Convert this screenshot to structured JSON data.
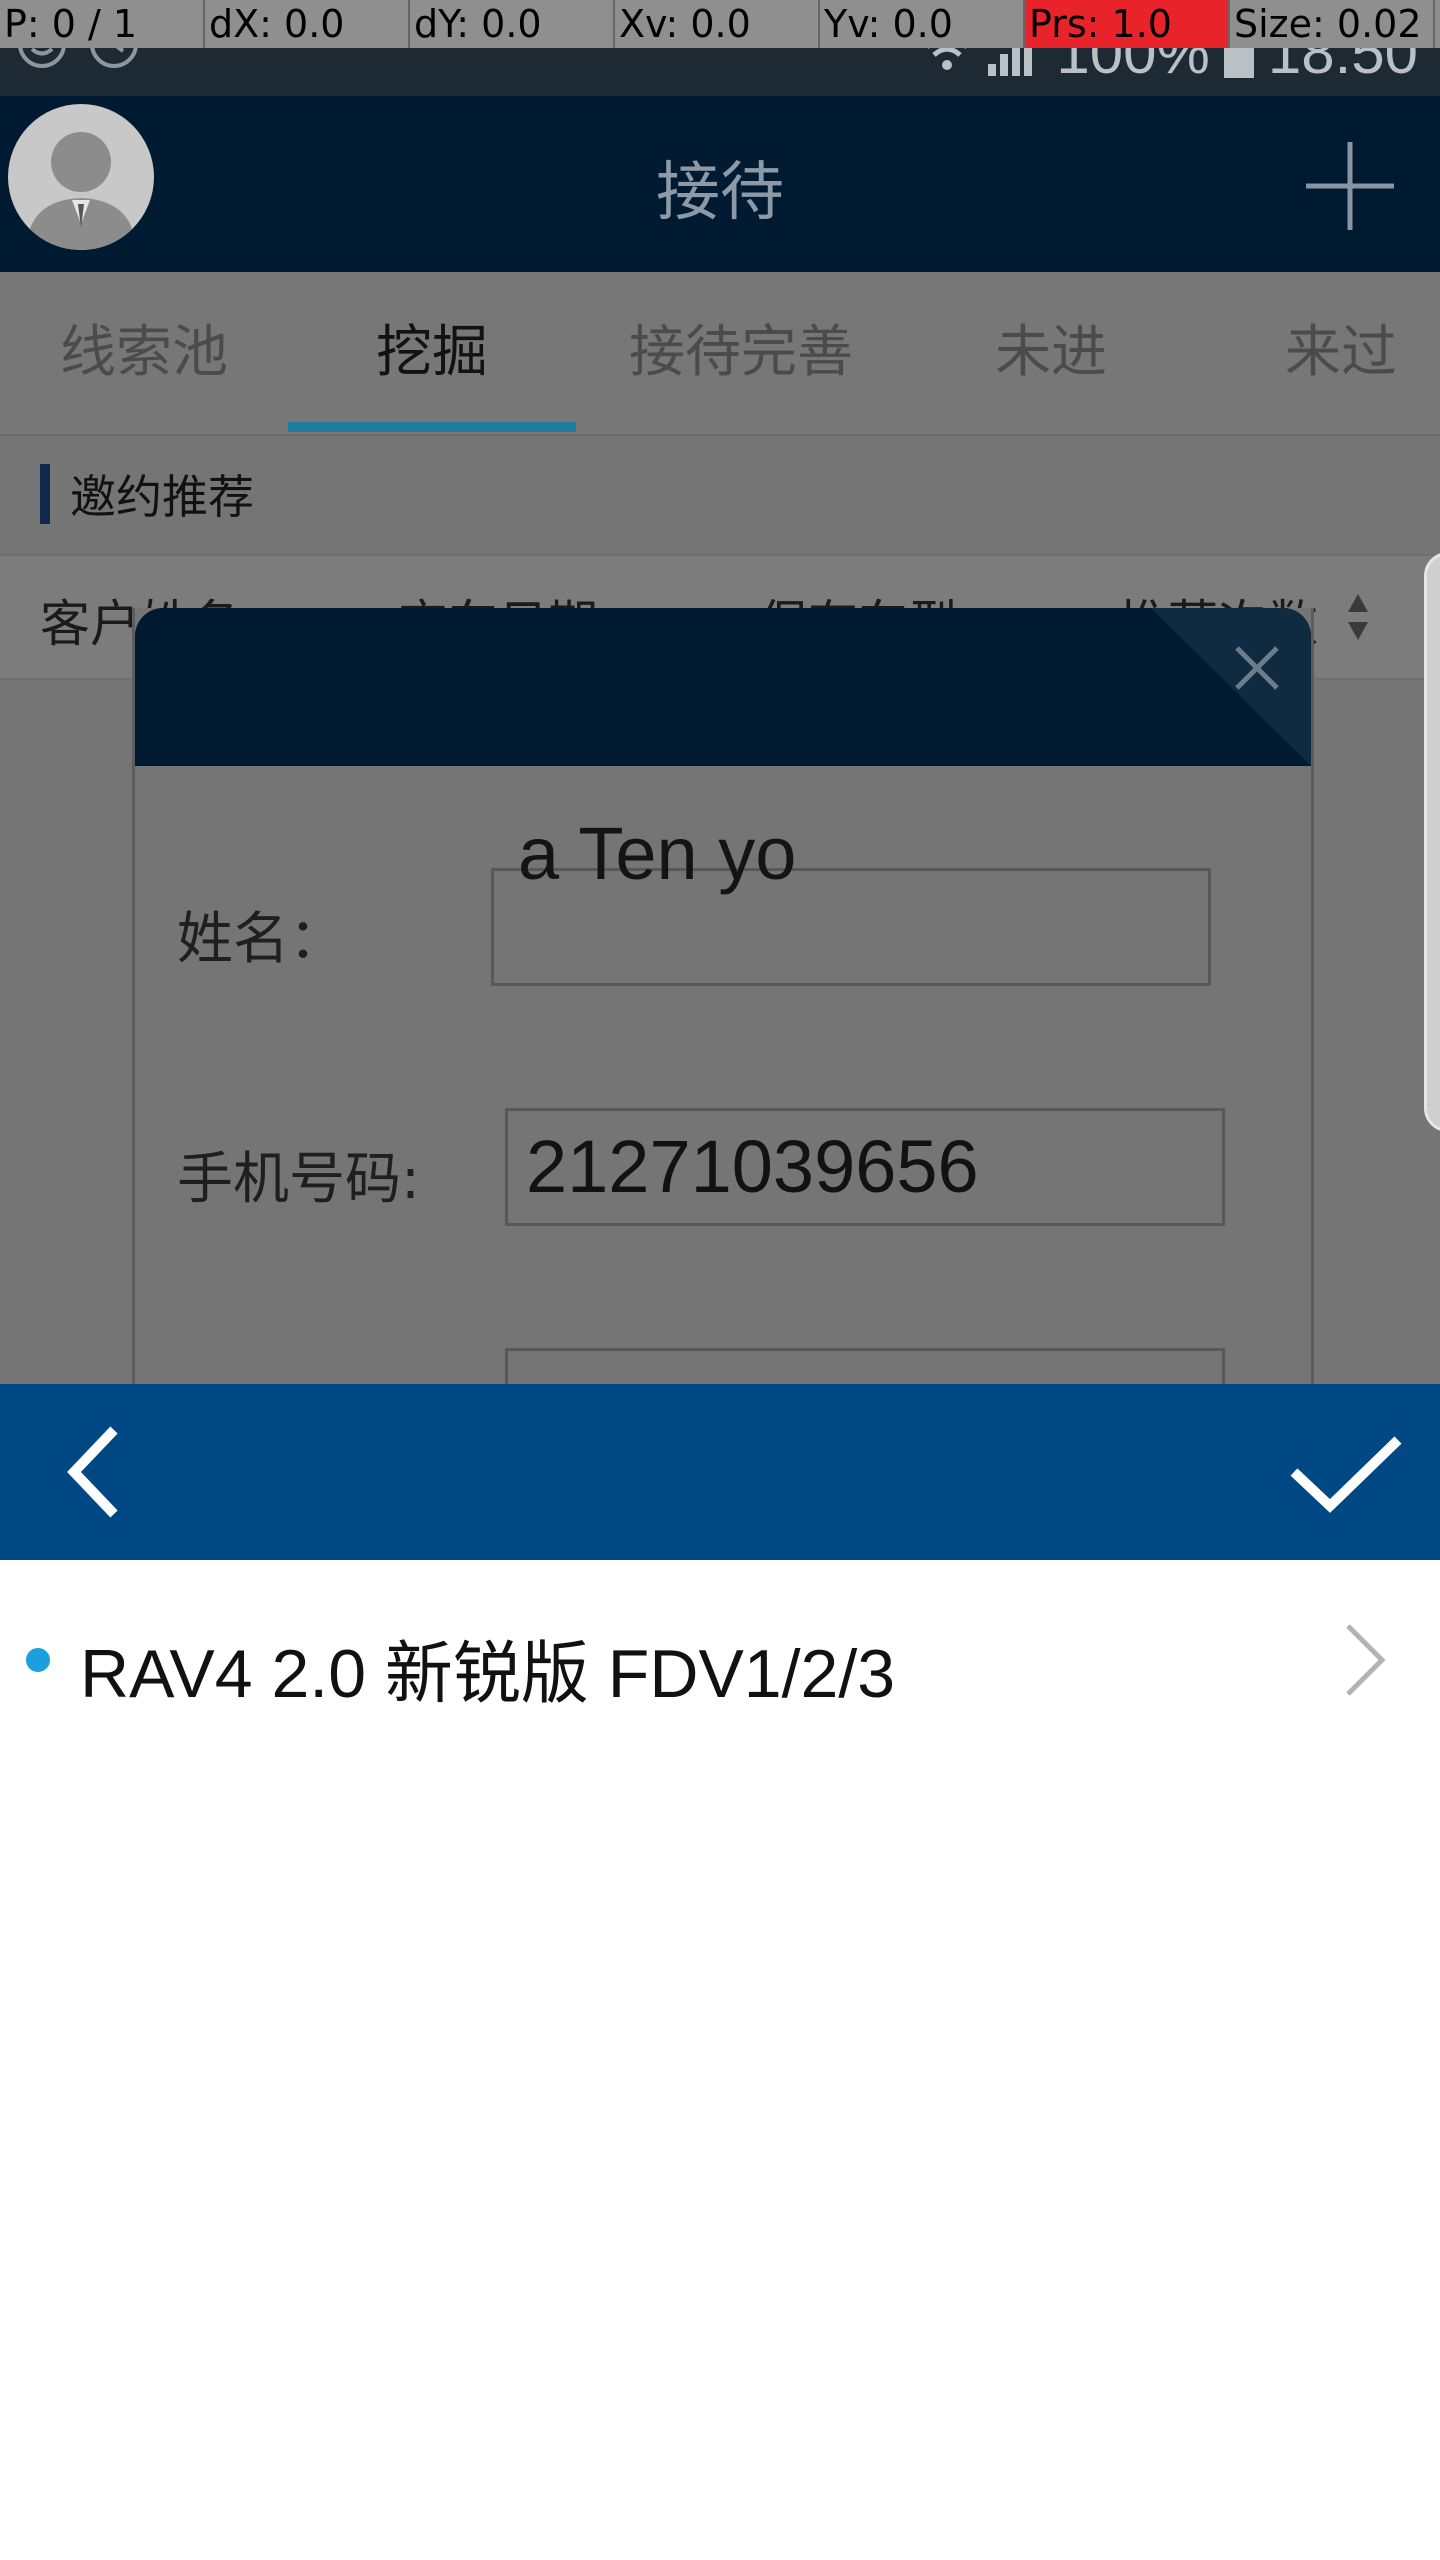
{
  "debug_overlay": {
    "pointer": "P: 0 / 1",
    "dx": "dX: 0.0",
    "dy": "dY: 0.0",
    "xv": "Xv: 0.0",
    "yv": "Yv: 0.0",
    "pressure": "Prs: 1.0",
    "size": "Size: 0.02"
  },
  "status_bar": {
    "battery": "100%",
    "time": "18:50"
  },
  "header": {
    "title": "接待"
  },
  "tabs": [
    {
      "label": "线索池",
      "active": false
    },
    {
      "label": "挖掘",
      "active": true
    },
    {
      "label": "接待完善",
      "active": false
    },
    {
      "label": "未进",
      "active": false
    },
    {
      "label": "来过",
      "active": false
    }
  ],
  "section": {
    "title": "邀约推荐"
  },
  "table": {
    "columns": [
      "客户姓名",
      "交车日期",
      "保有车型",
      "推荐次数"
    ]
  },
  "modal": {
    "name_label": "姓名：",
    "name_value": "a Ten yo",
    "phone_label": "手机号码:",
    "phone_value": "21271039656"
  },
  "sheet": {
    "items": [
      {
        "label": "RAV4 2.0 新锐版 FDV1/2/3"
      }
    ]
  },
  "colors": {
    "header_bg": "#001b31",
    "sheet_toolbar_bg": "#004884",
    "tab_indicator": "#1e7a9f",
    "list_dot": "#1aa0de"
  }
}
